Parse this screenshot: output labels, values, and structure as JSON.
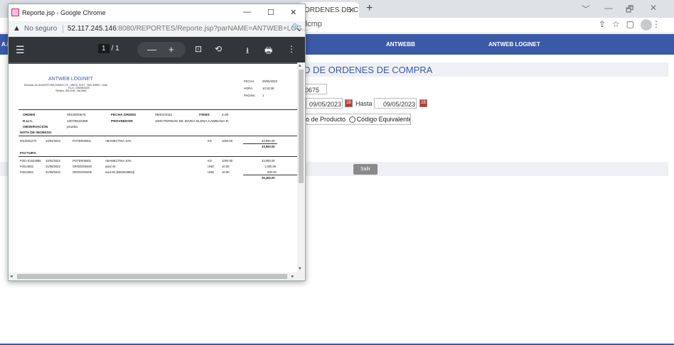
{
  "bg_browser": {
    "tab_title": "ORDENES DE C",
    "tab_close": "✕",
    "new_tab": "+",
    "window_controls": [
      "﹀",
      "—",
      "🗗",
      "✕"
    ],
    "address": "dcmp",
    "toolbar_icons": [
      "⇪",
      "☆",
      "▢"
    ],
    "menu_dots": "⋮",
    "nav_left": "A.I",
    "nav_items": [
      "ANTWEBB",
      "ANTWEB LOGINET"
    ],
    "page_title": "D DE ORDENES DE COMPRA",
    "order_no": "0675",
    "date_from": "09/05/2023",
    "hasta_label": "Hasta",
    "date_to": "09/05/2023",
    "cal_icon": "28",
    "radio_product": "go de Producto",
    "radio_equiv": "Código Equivalente",
    "salir_button": "Salir"
  },
  "popup": {
    "title": "Reporte.jsp - Google Chrome",
    "controls": [
      "—",
      "☐",
      "✕"
    ],
    "security_icon": "▲",
    "security_label": "No seguro",
    "url_host": "52.117.245.146",
    "url_rest": ":8080/REPORTES/Reporte.jsp?parNAME=ANTWEB+LOG...",
    "zoom_icon": "🔍",
    "pdf": {
      "menu_icon": "☰",
      "page_current": "1",
      "page_total": "/ 1",
      "zoom_out": "—",
      "zoom_in": "+",
      "fit_icon": "⊡",
      "rotate_icon": "⟲",
      "download_icon": "⭳",
      "print_icon": "🖶",
      "more_icon": "⋮"
    },
    "scroll": {
      "up": "▴",
      "down": "▾",
      "left": "◂",
      "right": "▸"
    }
  },
  "report": {
    "company": "ANTWEB LOGINET",
    "address": "Dirección: AV. AUGUSTO BOLOGNESI 170 - URB EL GOLF - SAN ISIDRO - LIMA",
    "ruc_line": "R.U.C. 20519840220",
    "phone_line": "Teléfono: 264-0148 / 264-0860",
    "fecha_label": "FECHA:",
    "fecha_value": "09/05/2023",
    "hora_label": "HORA:",
    "hora_value": "10:10:28",
    "pagina_label": "PAGINA:",
    "pagina_value": "1",
    "orden_label": "ORDEN",
    "orden_value": "0010000675",
    "fecha_orden_label": "FECHA ORDEN",
    "fecha_orden_value": "09/02/2022",
    "items_label": "ITEMS",
    "items_value": "2.00",
    "ruc_label": "R.U.C.",
    "ruc_value": "10078010369",
    "proveedor_label": "PROVEEDOR",
    "proveedor_value": "1000 PERNOS DE MARIA ELENA CAMBANA R.",
    "obs_label": "OBSERVACION",
    "obs_value": "prueba",
    "nota_title": "NOTA DE INGRESO",
    "nota_rows": [
      {
        "doc": "0010001270",
        "date": "10/02/2022",
        "code": "POTER00001",
        "desc": "ABAMECTINA 10%",
        "unit": "KG",
        "qty": "1000.00",
        "amount": "33,950.00"
      }
    ],
    "nota_total": "33,950.00",
    "factura_title": "FACTURA",
    "factura_rows": [
      {
        "doc": "F001-01523888",
        "date": "10/02/2022",
        "code": "POTER00001",
        "desc": "ABAMECTINA 10%",
        "unit": "KG",
        "qty": "1000.00",
        "amount": "33,950.00"
      },
      {
        "doc": "F0014563",
        "date": "31/08/2022",
        "code": "SRODO00400",
        "desc": "axial 45",
        "unit": "UND",
        "qty": "10.00",
        "amount": "1,000.00"
      },
      {
        "doc": "F0014563",
        "date": "31/08/2022",
        "code": "SRODO00406",
        "desc": "axial 60 [5653028654]",
        "unit": "UND",
        "qty": "10.00",
        "amount": "500.00"
      }
    ],
    "factura_total": "35,450.00"
  }
}
